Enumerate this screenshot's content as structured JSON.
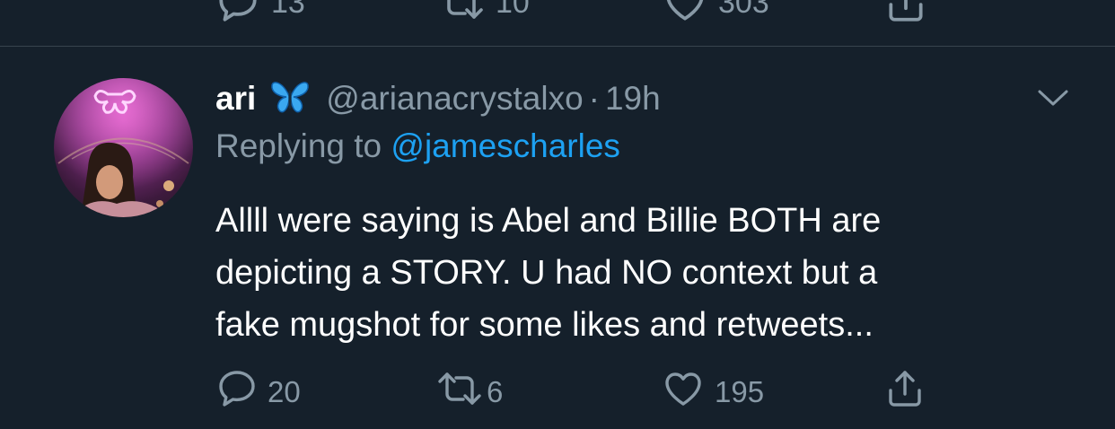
{
  "colors": {
    "background": "#15202b",
    "divider": "#38444d",
    "secondary_text": "#8899a6",
    "link": "#1da1f2",
    "primary_text": "#ffffff"
  },
  "previous_tweet": {
    "actions": [
      {
        "icon": "reply-icon",
        "count": "13"
      },
      {
        "icon": "retweet-icon",
        "count": "10"
      },
      {
        "icon": "like-icon",
        "count": "303"
      },
      {
        "icon": "share-icon",
        "count": ""
      }
    ]
  },
  "tweet": {
    "display_name": "ari",
    "name_emoji": "butterfly-emoji",
    "handle": "@arianacrystalxo",
    "separator": "·",
    "timestamp": "19h",
    "replying_prefix": "Replying to ",
    "replying_to": "@jamescharles",
    "text": "Allll were saying is Abel and Billie BOTH are\ndepicting a STORY. U had NO context but a\nfake mugshot for some likes and retweets...",
    "actions": {
      "reply": {
        "icon": "reply-icon",
        "count": "20"
      },
      "retweet": {
        "icon": "retweet-icon",
        "count": "6"
      },
      "like": {
        "icon": "like-icon",
        "count": "195"
      },
      "share": {
        "icon": "share-icon"
      }
    },
    "menu_icon": "chevron-down-icon"
  }
}
